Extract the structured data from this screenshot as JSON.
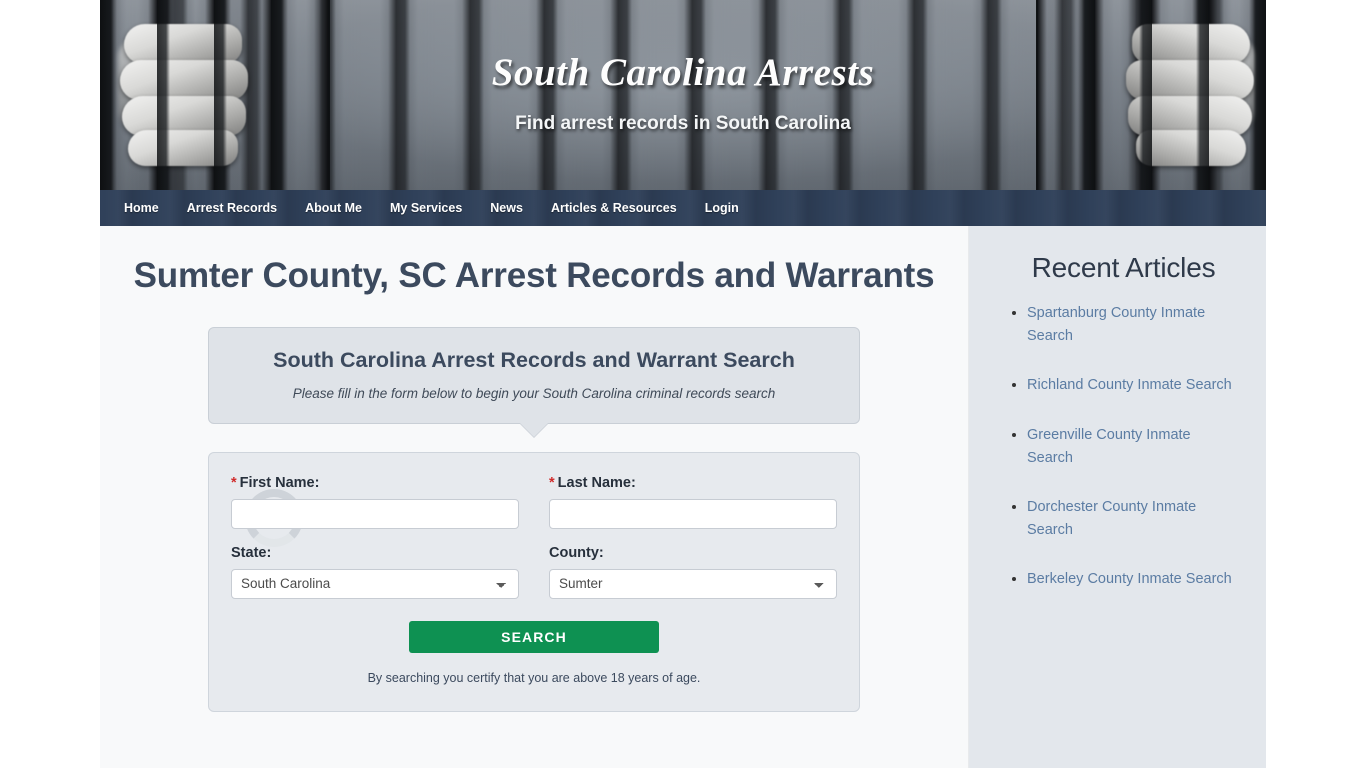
{
  "masthead": {
    "site_title": "South Carolina Arrests",
    "tagline": "Find arrest records in South Carolina",
    "photo_alt": "jail-bars-hands-photo"
  },
  "nav": {
    "items": [
      {
        "label": "Home"
      },
      {
        "label": "Arrest Records"
      },
      {
        "label": "About Me"
      },
      {
        "label": "My Services"
      },
      {
        "label": "News"
      },
      {
        "label": "Articles & Resources"
      },
      {
        "label": "Login"
      }
    ]
  },
  "main": {
    "page_title": "Sumter County, SC Arrest Records and Warrants",
    "callout": {
      "title": "South Carolina Arrest Records and Warrant Search",
      "subtitle": "Please fill in the form below to begin your South Carolina criminal records search"
    },
    "form": {
      "first_name_label": "First Name:",
      "first_name_value": "",
      "first_name_placeholder": "",
      "last_name_label": "Last Name:",
      "last_name_value": "",
      "last_name_placeholder": "",
      "state_label": "State:",
      "state_value": "South Carolina",
      "county_label": "County:",
      "county_value": "Sumter",
      "required_marker": "*",
      "submit_label": "SEARCH",
      "certify_text": "By searching you certify that you are above 18 years of age."
    }
  },
  "sidebar": {
    "title": "Recent Articles",
    "articles": [
      {
        "label": "Spartanburg County Inmate Search"
      },
      {
        "label": "Richland County Inmate Search"
      },
      {
        "label": "Greenville County Inmate Search"
      },
      {
        "label": "Dorchester County Inmate Search"
      },
      {
        "label": "Berkeley County Inmate Search"
      }
    ]
  },
  "colors": {
    "nav_bg": "#2f4059",
    "heading": "#3c4a5e",
    "button_green": "#0e9152",
    "link_blue": "#5b7ca3",
    "sidebar_bg": "#e3e7ec",
    "page_bg": "#f8f9fa",
    "required_red": "#d02b2b"
  }
}
